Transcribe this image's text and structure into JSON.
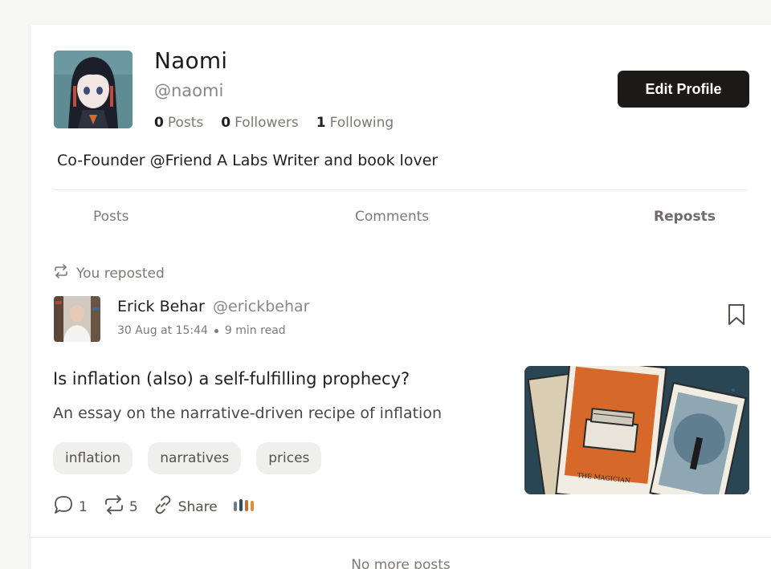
{
  "profile": {
    "name": "Naomi",
    "handle": "@naomi",
    "stats": [
      {
        "count": "0",
        "label": "Posts"
      },
      {
        "count": "0",
        "label": "Followers"
      },
      {
        "count": "1",
        "label": "Following"
      }
    ],
    "edit_label": "Edit Profile",
    "bio": "Co-Founder @Friend A Labs Writer and book lover"
  },
  "tabs": [
    {
      "label": "Posts",
      "active": false
    },
    {
      "label": "Comments",
      "active": false
    },
    {
      "label": "Reposts",
      "active": true
    }
  ],
  "feed": {
    "repost_label": "You reposted",
    "post": {
      "author_name": "Erick Behar",
      "author_handle": "@erickbehar",
      "date": "30 Aug at 15:44",
      "read_time": "9 min read",
      "title": "Is inflation (also) a self-fulfilling prophecy?",
      "subtitle": "An essay on the narrative-driven recipe of inflation",
      "tags": [
        "inflation",
        "narratives",
        "prices"
      ],
      "comment_count": "1",
      "repost_count": "5",
      "share_label": "Share",
      "thumbnail_card_label": "THE MAGICIAN"
    },
    "end_label": "No more posts"
  },
  "colors": {
    "button_bg": "#1b1a17",
    "muted_text": "#7d7a76",
    "tag_bg": "#efefee"
  },
  "icons": [
    "repost-icon",
    "bookmark-icon",
    "comment-icon",
    "share-icon",
    "stats-icon"
  ]
}
